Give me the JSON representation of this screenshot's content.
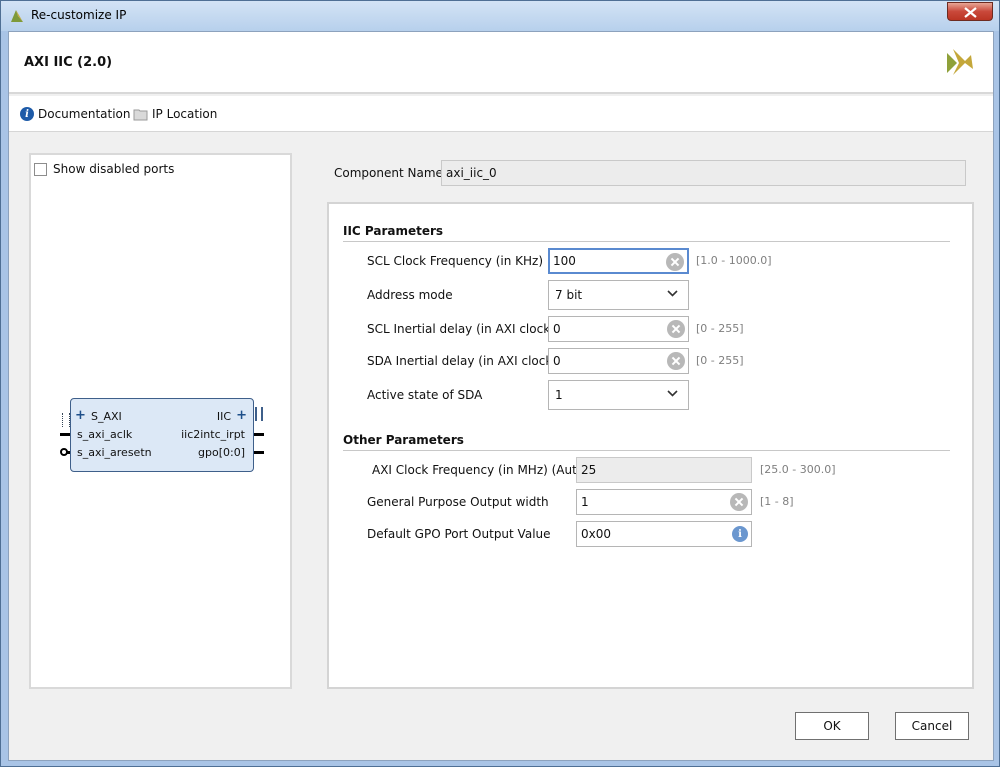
{
  "window": {
    "title": "Re-customize IP"
  },
  "header": {
    "title": "AXI IIC (2.0)"
  },
  "toolbar": {
    "documentation": "Documentation",
    "ip_location": "IP Location"
  },
  "left": {
    "show_disabled": "Show disabled ports",
    "block": {
      "s_axi": "S_AXI",
      "s_axi_aclk": "s_axi_aclk",
      "s_axi_aresetn": "s_axi_aresetn",
      "iic": "IIC",
      "iic2intc_irpt": "iic2intc_irpt",
      "gpo": "gpo[0:0]"
    }
  },
  "component": {
    "label": "Component Name",
    "value": "axi_iic_0"
  },
  "iic_params": {
    "title": "IIC Parameters",
    "scl_freq": {
      "label": "SCL Clock Frequency (in KHz)",
      "value": "100",
      "range": "[1.0 - 1000.0]"
    },
    "address_mode": {
      "label": "Address mode",
      "value": "7 bit"
    },
    "scl_delay": {
      "label": "SCL Inertial delay (in AXI clocks)",
      "value": "0",
      "range": "[0 - 255]"
    },
    "sda_delay": {
      "label": "SDA Inertial delay (in AXI clocks)",
      "value": "0",
      "range": "[0 - 255]"
    },
    "sda_active": {
      "label": "Active state of SDA",
      "value": "1"
    }
  },
  "other_params": {
    "title": "Other Parameters",
    "axi_clock": {
      "label": "AXI Clock Frequency (in MHz) (Auto)",
      "value": "25",
      "range": "[25.0 - 300.0]"
    },
    "gpo_width": {
      "label": "General Purpose Output width",
      "value": "1",
      "range": "[1 - 8]"
    },
    "gpo_default": {
      "label": "Default GPO Port Output Value",
      "value": "0x00"
    }
  },
  "buttons": {
    "ok": "OK",
    "cancel": "Cancel"
  },
  "colors": {
    "accent": "#5a8ad0",
    "titlebar": "#b7d0ec",
    "close": "#c9483a"
  }
}
